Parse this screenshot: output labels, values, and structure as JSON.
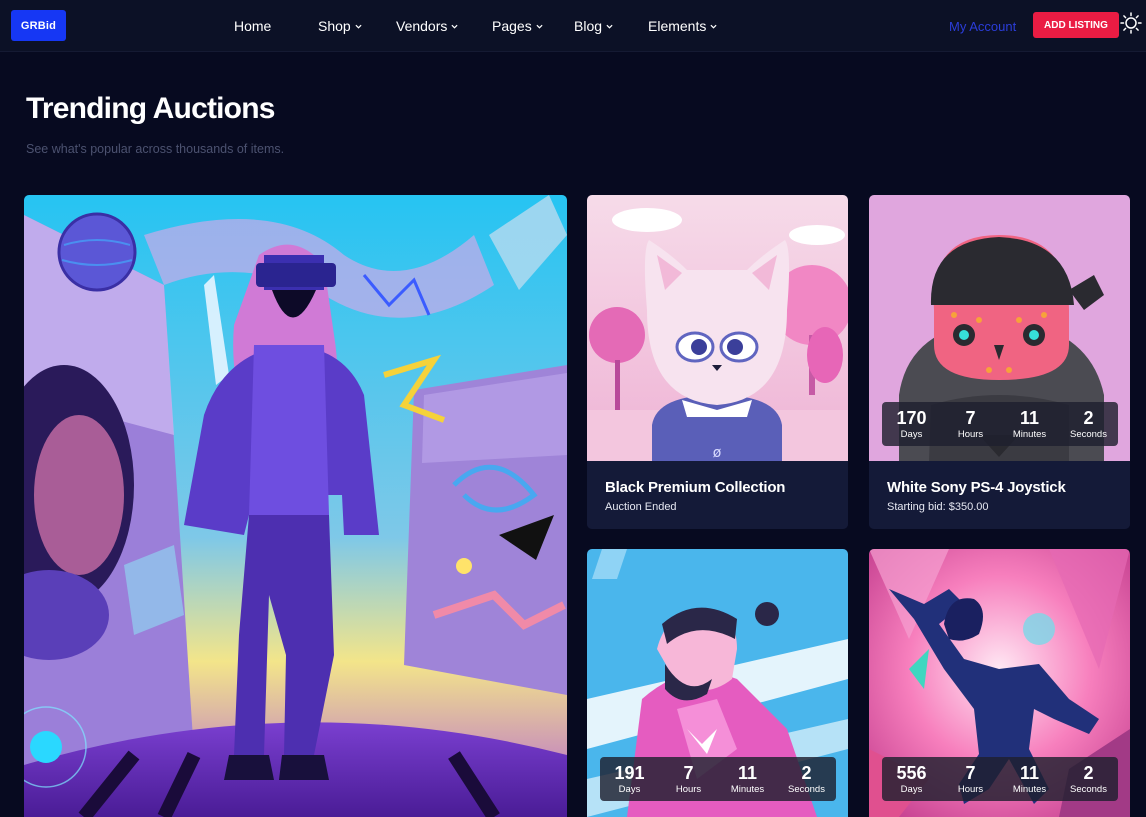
{
  "brand": {
    "logo": "GRBid"
  },
  "nav": {
    "items": [
      {
        "label": "Home",
        "dropdown": false
      },
      {
        "label": "Shop",
        "dropdown": true
      },
      {
        "label": "Vendors",
        "dropdown": true
      },
      {
        "label": "Pages",
        "dropdown": true
      },
      {
        "label": "Blog",
        "dropdown": true
      },
      {
        "label": "Elements",
        "dropdown": true
      }
    ],
    "account": "My Account",
    "cta": "ADD LISTING",
    "theme_icon": "sun-icon"
  },
  "section": {
    "title": "Trending Auctions",
    "subtitle": "See what's popular across thousands of items."
  },
  "timer_labels": {
    "days": "Days",
    "hours": "Hours",
    "minutes": "Minutes",
    "seconds": "Seconds"
  },
  "cards": [
    {
      "id": "featured",
      "title": "",
      "meta": ""
    },
    {
      "id": "cat",
      "title": "Black Premium Collection",
      "meta": "Auction Ended"
    },
    {
      "id": "skull",
      "title": "White Sony PS-4 Joystick",
      "meta": "Starting bid: $350.00",
      "timer": {
        "days": "170",
        "hours": "7",
        "minutes": "11",
        "seconds": "2"
      }
    },
    {
      "id": "runner",
      "title": "",
      "meta": "",
      "timer": {
        "days": "191",
        "hours": "7",
        "minutes": "11",
        "seconds": "2"
      }
    },
    {
      "id": "dancer",
      "title": "",
      "meta": "",
      "timer": {
        "days": "556",
        "hours": "7",
        "minutes": "11",
        "seconds": "2"
      }
    }
  ],
  "colors": {
    "background": "#070a20",
    "nav": "#0c1126",
    "brand": "#1637f4",
    "cta": "#ea1c43",
    "account": "#2b3dd9",
    "card": "#141a38"
  }
}
